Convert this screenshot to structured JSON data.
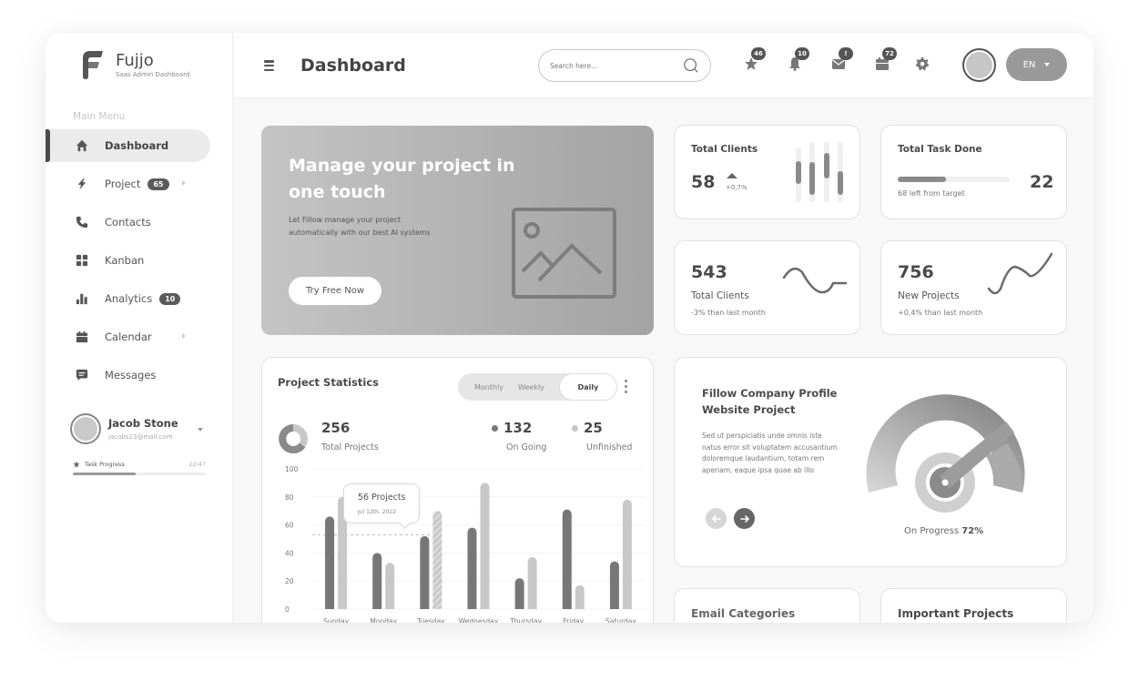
{
  "brand": {
    "name": "Fujjo",
    "tagline": "Saas Admin Dashboard"
  },
  "sidebar": {
    "section_title": "Main Menu",
    "items": [
      {
        "label": "Dashboard",
        "icon": "home-icon",
        "active": true
      },
      {
        "label": "Project",
        "icon": "bolt-icon",
        "badge": "65",
        "has_submenu": true
      },
      {
        "label": "Contacts",
        "icon": "phone-icon"
      },
      {
        "label": "Kanban",
        "icon": "grid-icon"
      },
      {
        "label": "Analytics",
        "icon": "bar-chart-icon",
        "badge": "10"
      },
      {
        "label": "Calendar",
        "icon": "calendar-icon",
        "has_submenu": true
      },
      {
        "label": "Messages",
        "icon": "message-icon"
      }
    ],
    "user": {
      "name": "Jacob Stone",
      "email": "jacobs23@mail.com"
    },
    "task_progress": {
      "label": "Task Progress",
      "value": "22/47",
      "fraction": 0.47
    }
  },
  "header": {
    "title": "Dashboard",
    "search_placeholder": "Search here...",
    "notifications": [
      {
        "icon": "star-icon",
        "badge": "46"
      },
      {
        "icon": "bell-icon",
        "badge": "10"
      },
      {
        "icon": "mail-icon",
        "badge": "!"
      },
      {
        "icon": "calendar-icon",
        "badge": "72"
      },
      {
        "icon": "gear-icon"
      }
    ],
    "language": "EN"
  },
  "banner": {
    "title": "Manage your project in one touch",
    "text": "Let Fillow manage your project automatically with our best AI systems",
    "button": "Try Free Now"
  },
  "stats": {
    "total_clients": {
      "title": "Total Clients",
      "value": "58",
      "change": "+0,7%"
    },
    "total_task_done": {
      "title": "Total Task Done",
      "value": "22",
      "note": "68 left from target",
      "progress": 0.43
    },
    "clients_month": {
      "value": "543",
      "label": "Total Clients",
      "note": "-3% than last month"
    },
    "new_projects": {
      "value": "756",
      "label": "New Projects",
      "note": "+0,4% than last month"
    }
  },
  "project_statistics": {
    "title": "Project Statistics",
    "tabs": [
      "Monthly",
      "Weekly",
      "Daily"
    ],
    "active_tab": "Daily",
    "total": {
      "value": "256",
      "label": "Total Projects"
    },
    "ongoing": {
      "value": "132",
      "label": "On Going",
      "color": "#777777"
    },
    "unfinished": {
      "value": "25",
      "label": "Unfinished",
      "color": "#c8c8c8"
    },
    "tooltip": {
      "title": "56 Projects",
      "date": "Jul 12th, 2022"
    }
  },
  "chart_data": {
    "type": "bar",
    "title": "Project Statistics",
    "categories": [
      "Sunday",
      "Monday",
      "Tuesday",
      "Wednesday",
      "Thursday",
      "Friday",
      "Saturday"
    ],
    "series": [
      {
        "name": "On Going",
        "color": "#777777",
        "values": [
          66,
          40,
          52,
          58,
          22,
          71,
          34
        ]
      },
      {
        "name": "Unfinished",
        "color": "#c8c8c8",
        "values": [
          80,
          33,
          70,
          90,
          37,
          17,
          78
        ]
      }
    ],
    "yticks": [
      0,
      20,
      40,
      60,
      80,
      100
    ],
    "ylim": [
      0,
      100
    ],
    "reference_line": 53,
    "highlight": {
      "category": "Tuesday",
      "series": "Unfinished",
      "style": "hatched"
    },
    "grid": true
  },
  "company_project": {
    "title": "Fillow Company Profile Website Project",
    "text": "Sed ut perspiciatis unde omnis iste natus error sit voluptatem accusantium doloremque laudantium, totam rem aperiam, eaque ipsa quae ab illo",
    "progress_label": "On Progress",
    "progress_value": "72%",
    "progress": 0.72
  },
  "bottom_cards": {
    "email_categories": "Email Categories",
    "important_projects": "Important Projects"
  }
}
